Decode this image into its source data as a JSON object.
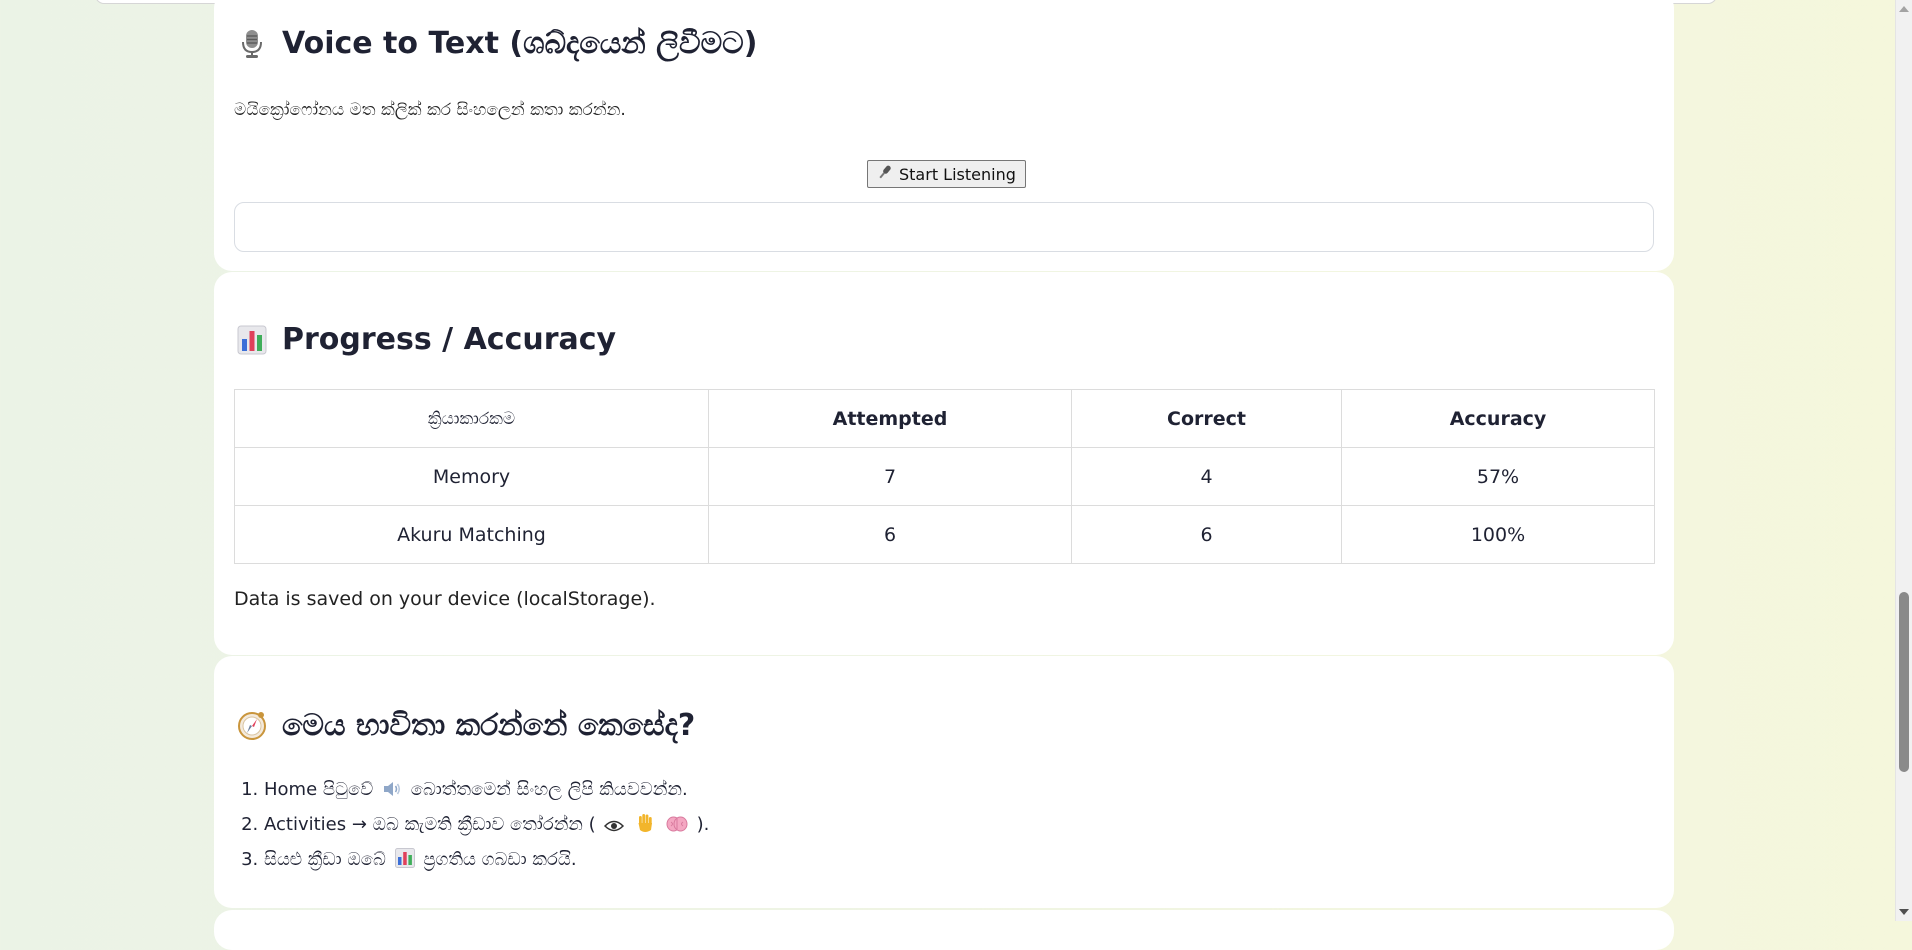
{
  "voice": {
    "icon": "microphone-icon",
    "title": "Voice to Text (ශබ්දයෙන් ලිවීමට)",
    "description": "මයික්‍රෝෆෝනය මත ක්ලික් කර සිංහලෙන් කතා කරන්න.",
    "button_icon": "mic-icon",
    "button_label": "Start Listening",
    "output_text": ""
  },
  "progress": {
    "icon": "bar-chart-icon",
    "title": "Progress / Accuracy",
    "columns": [
      "ක්‍රියාකාරකම",
      "Attempted",
      "Correct",
      "Accuracy"
    ],
    "rows": [
      [
        "Memory",
        "7",
        "4",
        "57%"
      ],
      [
        "Akuru Matching",
        "6",
        "6",
        "100%"
      ]
    ],
    "note": "Data is saved on your device (localStorage)."
  },
  "howto": {
    "icon": "compass-icon",
    "title": "මෙය භාවිතා කරන්නේ කෙසේද?",
    "steps": [
      {
        "before": "Home පිටුවේ",
        "icons": [
          "speaker-icon"
        ],
        "after": "බොත්තමෙන් සිංහල ලිපි කියවවන්න."
      },
      {
        "before": "Activities → ඔබ කැමති ක්‍රීඩාව තෝරන්න (",
        "icons": [
          "eye-icon",
          "hand-icon",
          "brain-icon"
        ],
        "after": ")."
      },
      {
        "before": "සියළු ක්‍රීඩා ඔබේ",
        "icons": [
          "bar-chart-icon"
        ],
        "after": "ප්‍රගතිය ගබඩා කරයි."
      }
    ]
  },
  "colors": {
    "background_start": "#ebf3e6",
    "background_end": "#f5f7dc",
    "card": "#ffffff",
    "heading_text": "#1f2233",
    "table_border": "#dcdcdc"
  }
}
